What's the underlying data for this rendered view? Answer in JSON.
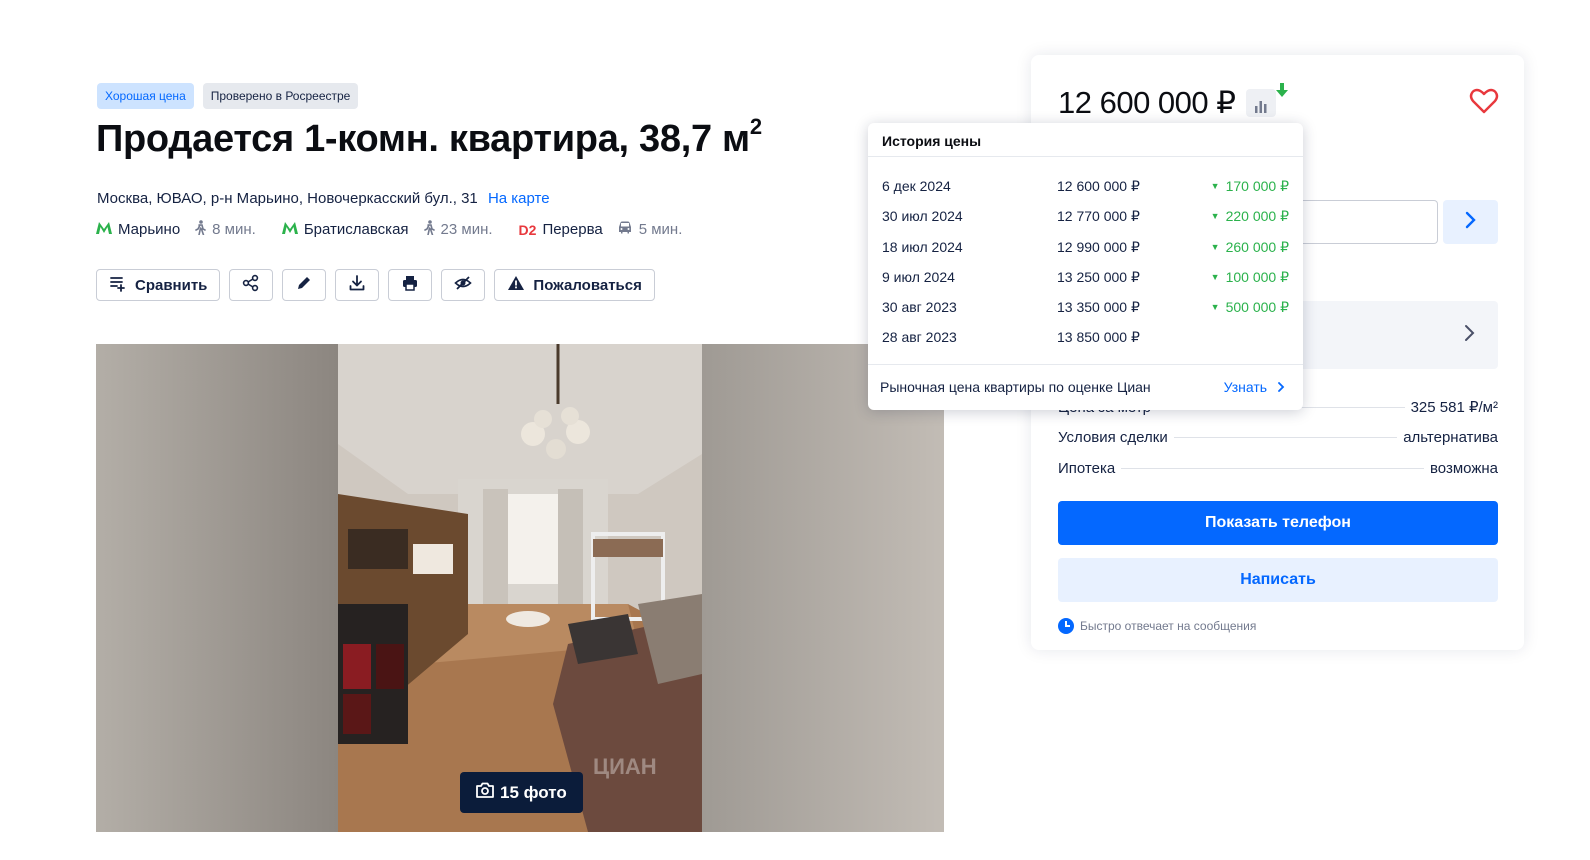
{
  "badges": {
    "good_price": "Хорошая цена",
    "verified": "Проверено в Росреестре"
  },
  "title": {
    "text": "Продается 1-комн. квартира, 38,7 м",
    "superscript": "2"
  },
  "address": {
    "text": "Москва, ЮВАО, р-н Марьино, Новочеркасский бул., 31",
    "map_link": "На карте"
  },
  "stations": [
    {
      "icon": "metro-icon",
      "name": "Марьино",
      "mode_icon": "walk-icon",
      "time": "8 мин."
    },
    {
      "icon": "metro-icon",
      "name": "Братиславская",
      "mode_icon": "walk-icon",
      "time": "23 мин."
    },
    {
      "icon": "d2-icon",
      "badge": "D2",
      "name": "Перерва",
      "mode_icon": "car-icon",
      "time": "5 мин."
    }
  ],
  "toolbar": {
    "compare_label": "Сравнить",
    "report_label": "Пожаловаться",
    "icons": [
      "compare-icon",
      "share-icon",
      "edit-icon",
      "download-icon",
      "print-icon",
      "hide-icon",
      "warning-icon"
    ]
  },
  "gallery": {
    "photo_count_label": "15 фото",
    "watermark": "ЦИАН"
  },
  "card": {
    "price": "12 600 000 ₽",
    "price_trend": "down",
    "params": [
      {
        "label": "Цена за метр",
        "value": "325 581 ₽/м²"
      },
      {
        "label": "Условия сделки",
        "value": "альтернатива"
      },
      {
        "label": "Ипотека",
        "value": "возможна"
      }
    ],
    "show_phone_label": "Показать телефон",
    "write_label": "Написать",
    "quick_reply_label": "Быстро отвечает на сообщения"
  },
  "price_history": {
    "title": "История цены",
    "rows": [
      {
        "date": "6 дек 2024",
        "price": "12 600 000 ₽",
        "change": "170 000 ₽"
      },
      {
        "date": "30 июл 2024",
        "price": "12 770 000 ₽",
        "change": "220 000 ₽"
      },
      {
        "date": "18 июл 2024",
        "price": "12 990 000 ₽",
        "change": "260 000 ₽"
      },
      {
        "date": "9 июл 2024",
        "price": "13 250 000 ₽",
        "change": "100 000 ₽"
      },
      {
        "date": "30 авг 2023",
        "price": "13 350 000 ₽",
        "change": "500 000 ₽"
      },
      {
        "date": "28 авг 2023",
        "price": "13 850 000 ₽",
        "change": ""
      }
    ],
    "footer_text": "Рыночная цена квартиры по оценке Циан",
    "footer_link": "Узнать"
  },
  "colors": {
    "accent": "#0468ff",
    "price_drop": "#2bb24c",
    "metro": "#2bb24c",
    "d2": "#e8383d",
    "heart": "#e8383d"
  }
}
